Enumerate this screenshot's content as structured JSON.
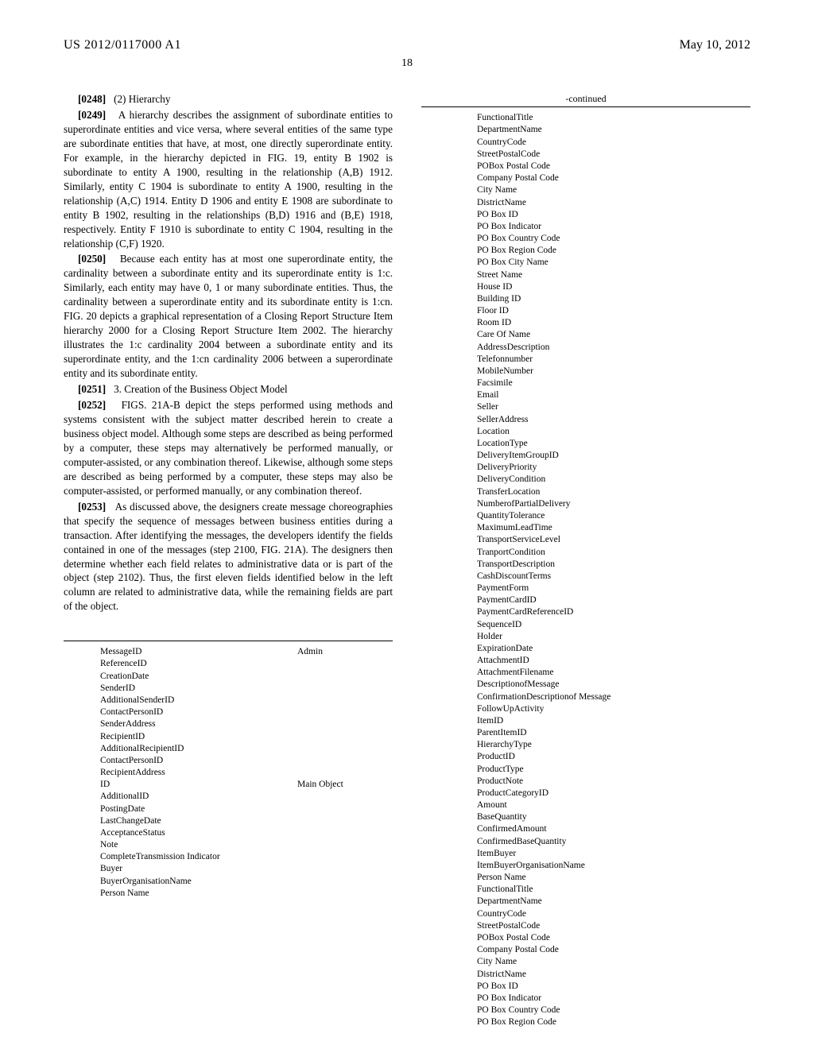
{
  "header": {
    "pubnum": "US 2012/0117000 A1",
    "date": "May 10, 2012"
  },
  "pagenum": "18",
  "left": {
    "p0248": {
      "num": "[0248]",
      "text": "(2) Hierarchy"
    },
    "p0249": {
      "num": "[0249]",
      "text": "A hierarchy describes the assignment of subordinate entities to superordinate entities and vice versa, where several entities of the same type are subordinate entities that have, at most, one directly superordinate entity. For example, in the hierarchy depicted in FIG. 19, entity B 1902 is subordinate to entity A 1900, resulting in the relationship (A,B) 1912. Similarly, entity C 1904 is subordinate to entity A 1900, resulting in the relationship (A,C) 1914. Entity D 1906 and entity E 1908 are subordinate to entity B 1902, resulting in the relationships (B,D) 1916 and (B,E) 1918, respectively. Entity F 1910 is subordinate to entity C 1904, resulting in the relationship (C,F) 1920."
    },
    "p0250": {
      "num": "[0250]",
      "text": "Because each entity has at most one superordinate entity, the cardinality between a subordinate entity and its superordinate entity is 1:c. Similarly, each entity may have 0, 1 or many subordinate entities. Thus, the cardinality between a superordinate entity and its subordinate entity is 1:cn. FIG. 20 depicts a graphical representation of a Closing Report Structure Item hierarchy 2000 for a Closing Report Structure Item 2002. The hierarchy illustrates the 1:c cardinality 2004 between a subordinate entity and its superordinate entity, and the 1:cn cardinality 2006 between a superordinate entity and its subordinate entity."
    },
    "p0251": {
      "num": "[0251]",
      "text": "3. Creation of the Business Object Model"
    },
    "p0252": {
      "num": "[0252]",
      "text": "FIGS. 21A-B depict the steps performed using methods and systems consistent with the subject matter described herein to create a business object model. Although some steps are described as being performed by a computer, these steps may alternatively be performed manually, or computer-assisted, or any combination thereof. Likewise, although some steps are described as being performed by a computer, these steps may also be computer-assisted, or performed manually, or any combination thereof."
    },
    "p0253": {
      "num": "[0253]",
      "text": "As discussed above, the designers create message choreographies that specify the sequence of messages between business entities during a transaction. After identifying the messages, the developers identify the fields contained in one of the messages (step 2100, FIG. 21A). The designers then determine whether each field relates to administrative data or is part of the object (step 2102). Thus, the first eleven fields identified below in the left column are related to administrative data, while the remaining fields are part of the object."
    },
    "fields": [
      {
        "name": "MessageID",
        "tag": "Admin"
      },
      {
        "name": "ReferenceID",
        "tag": ""
      },
      {
        "name": "CreationDate",
        "tag": ""
      },
      {
        "name": "SenderID",
        "tag": ""
      },
      {
        "name": "AdditionalSenderID",
        "tag": ""
      },
      {
        "name": "ContactPersonID",
        "tag": ""
      },
      {
        "name": "SenderAddress",
        "tag": ""
      },
      {
        "name": "RecipientID",
        "tag": ""
      },
      {
        "name": "AdditionalRecipientID",
        "tag": ""
      },
      {
        "name": "ContactPersonID",
        "tag": ""
      },
      {
        "name": "RecipientAddress",
        "tag": ""
      },
      {
        "name": "ID",
        "tag": "Main Object"
      },
      {
        "name": "AdditionalID",
        "tag": ""
      },
      {
        "name": "PostingDate",
        "tag": ""
      },
      {
        "name": "LastChangeDate",
        "tag": ""
      },
      {
        "name": "AcceptanceStatus",
        "tag": ""
      },
      {
        "name": "Note",
        "tag": ""
      },
      {
        "name": "CompleteTransmission Indicator",
        "tag": ""
      },
      {
        "name": "Buyer",
        "tag": ""
      },
      {
        "name": "BuyerOrganisationName",
        "tag": ""
      },
      {
        "name": "Person Name",
        "tag": ""
      }
    ]
  },
  "right": {
    "continued_label": "-continued",
    "fields": [
      "FunctionalTitle",
      "DepartmentName",
      "CountryCode",
      "StreetPostalCode",
      "POBox Postal Code",
      "Company Postal Code",
      "City Name",
      "DistrictName",
      "PO Box ID",
      "PO Box Indicator",
      "PO Box Country Code",
      "PO Box Region Code",
      "PO Box City Name",
      "Street Name",
      "House ID",
      "Building ID",
      "Floor ID",
      "Room ID",
      "Care Of Name",
      "AddressDescription",
      "Telefonnumber",
      "MobileNumber",
      "Facsimile",
      "Email",
      "Seller",
      "SellerAddress",
      "Location",
      "LocationType",
      "DeliveryItemGroupID",
      "DeliveryPriority",
      "DeliveryCondition",
      "TransferLocation",
      "NumberofPartialDelivery",
      "QuantityTolerance",
      "MaximumLeadTime",
      "TransportServiceLevel",
      "TranportCondition",
      "TransportDescription",
      "CashDiscountTerms",
      "PaymentForm",
      "PaymentCardID",
      "PaymentCardReferenceID",
      "SequenceID",
      "Holder",
      "ExpirationDate",
      "AttachmentID",
      "AttachmentFilename",
      "DescriptionofMessage",
      "ConfirmationDescriptionof Message",
      "FollowUpActivity",
      "ItemID",
      "ParentItemID",
      "HierarchyType",
      "ProductID",
      "ProductType",
      "ProductNote",
      "ProductCategoryID",
      "Amount",
      "BaseQuantity",
      "ConfirmedAmount",
      "ConfirmedBaseQuantity",
      "ItemBuyer",
      "ItemBuyerOrganisationName",
      "Person Name",
      "FunctionalTitle",
      "DepartmentName",
      "CountryCode",
      "StreetPostalCode",
      "POBox Postal Code",
      "Company Postal Code",
      "City Name",
      "DistrictName",
      "PO Box ID",
      "PO Box Indicator",
      "PO Box Country Code",
      "PO Box Region Code"
    ]
  }
}
